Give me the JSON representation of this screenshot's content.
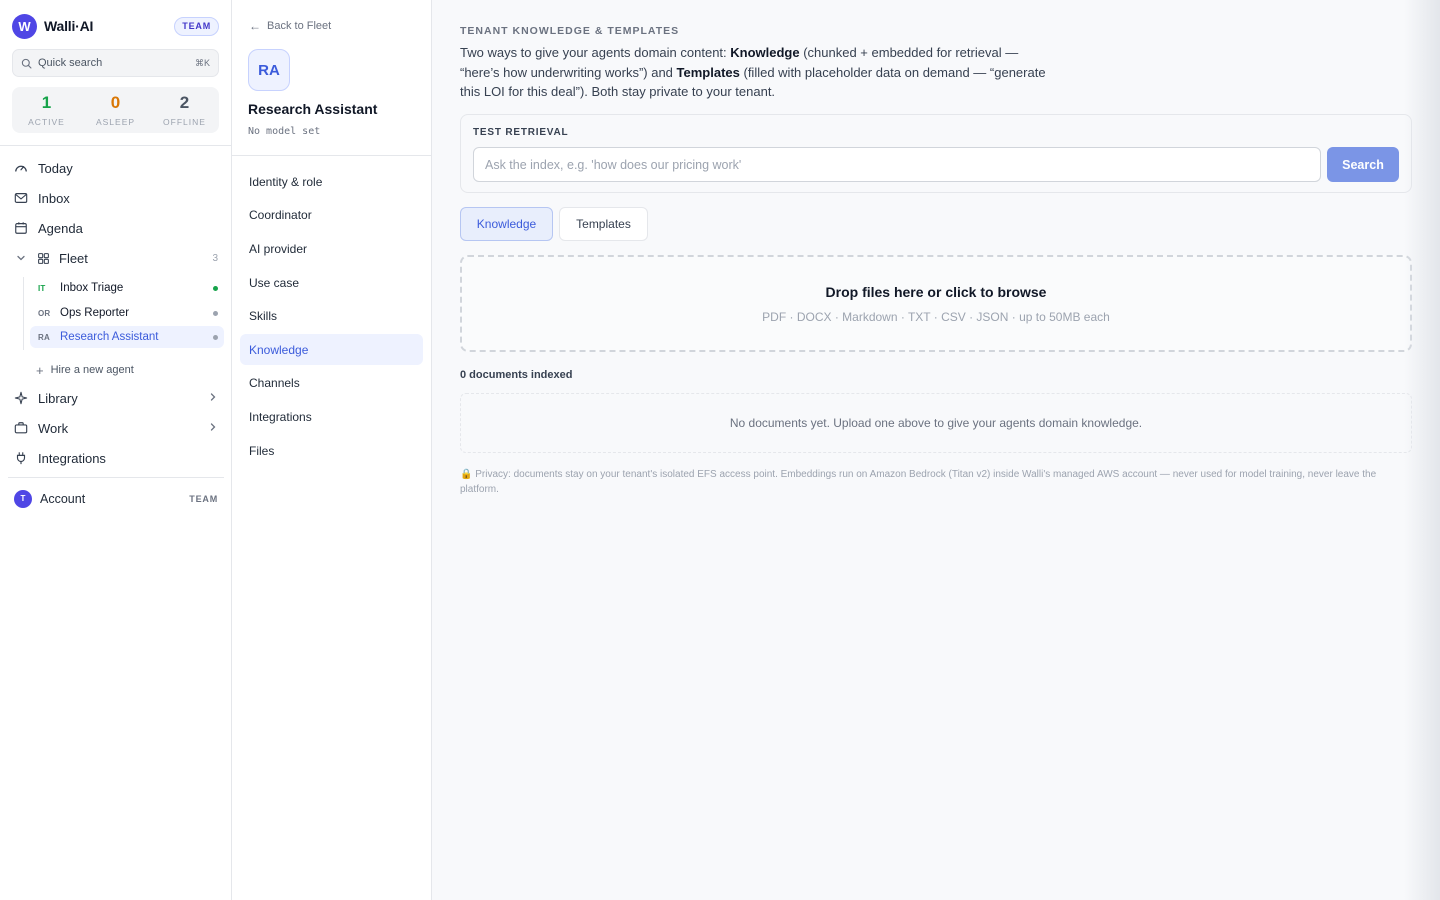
{
  "app": {
    "logo_letter": "W",
    "name": "Walli·AI",
    "plan_badge": "TEAM"
  },
  "search": {
    "label": "Quick search",
    "shortcut": "⌘K"
  },
  "stats": [
    {
      "value": "1",
      "label": "ACTIVE",
      "color": "#16a34a"
    },
    {
      "value": "0",
      "label": "ASLEEP",
      "color": "#d97706"
    },
    {
      "value": "2",
      "label": "OFFLINE",
      "color": "#4b5563"
    }
  ],
  "nav": {
    "today": "Today",
    "inbox": "Inbox",
    "agenda": "Agenda",
    "fleet": "Fleet",
    "fleet_count": "3",
    "library": "Library",
    "work": "Work",
    "integrations": "Integrations"
  },
  "fleet_agents": [
    {
      "initials": "IT",
      "name": "Inbox Triage",
      "status": "active"
    },
    {
      "initials": "OR",
      "name": "Ops Reporter",
      "status": "offline"
    },
    {
      "initials": "RA",
      "name": "Research Assistant",
      "status": "offline"
    }
  ],
  "hire_label": "Hire a new agent",
  "account": {
    "avatar": "T",
    "label": "Account",
    "badge": "TEAM"
  },
  "agent": {
    "back_label": "Back to Fleet",
    "initials": "RA",
    "name": "Research Assistant",
    "model": "No model set"
  },
  "config_menu": [
    "Identity & role",
    "Coordinator",
    "AI provider",
    "Use case",
    "Skills",
    "Knowledge",
    "Channels",
    "Integrations",
    "Files"
  ],
  "main": {
    "section_title": "TENANT KNOWLEDGE & TEMPLATES",
    "intro": {
      "p1": "Two ways to give your agents domain content: ",
      "b1": "Knowledge",
      "p2": " (chunked + embedded for retrieval — “here’s how underwriting works”) and ",
      "b2": "Templates",
      "p3": " (filled with placeholder data on demand — “generate this LOI for this deal”). Both stay private to your tenant."
    },
    "retrieval": {
      "title": "TEST RETRIEVAL",
      "placeholder": "Ask the index, e.g. 'how does our pricing work'",
      "value": "",
      "button": "Search"
    },
    "tabs": [
      "Knowledge",
      "Templates"
    ],
    "dropzone": {
      "title": "Drop files here or click to browse",
      "subtitle": "PDF · DOCX · Markdown · TXT · CSV · JSON · up to 50MB each"
    },
    "doc_count": "0 documents indexed",
    "empty_state": "No documents yet. Upload one above to give your agents domain knowledge.",
    "privacy": "🔒 Privacy: documents stay on your tenant's isolated EFS access point. Embeddings run on Amazon Bedrock (Titan v2) inside Walli's managed AWS account — never used for model training, never leave the platform."
  }
}
